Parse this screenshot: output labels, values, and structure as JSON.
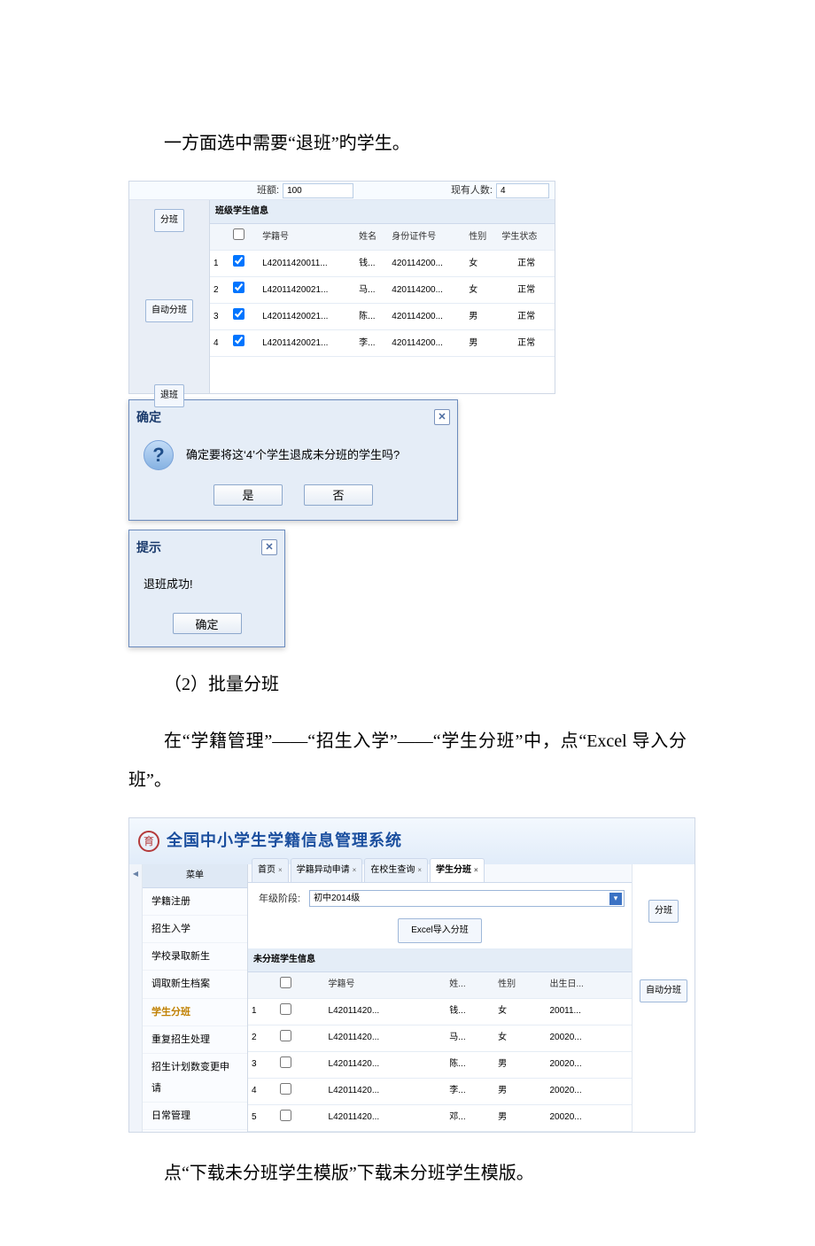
{
  "text": {
    "p1": "一方面选中需要“退班”旳学生。",
    "p2_a": "（2）批量分班",
    "p2_b": "在“学籍管理”——“招生入学”——“学生分班”中，点“Excel 导入分班”。",
    "p3": "点“下载未分班学生模版”下载未分班学生模版。"
  },
  "panel1": {
    "btn_fen": "分班",
    "btn_auto": "自动分班",
    "btn_tui": "退班",
    "lbl_ban_e": "班额:",
    "val_ban_e": "100",
    "lbl_xian": "现有人数:",
    "val_xian": "4",
    "section": "班级学生信息",
    "cols": [
      "",
      "",
      "学籍号",
      "姓名",
      "身份证件号",
      "性别",
      "学生状态"
    ],
    "rows": [
      {
        "n": "1",
        "chk": true,
        "id": "L42011420011...",
        "name": "钱...",
        "card": "420114200...",
        "sex": "女",
        "st": "正常"
      },
      {
        "n": "2",
        "chk": true,
        "id": "L42011420021...",
        "name": "马...",
        "card": "420114200...",
        "sex": "女",
        "st": "正常"
      },
      {
        "n": "3",
        "chk": true,
        "id": "L42011420021...",
        "name": "陈...",
        "card": "420114200...",
        "sex": "男",
        "st": "正常"
      },
      {
        "n": "4",
        "chk": true,
        "id": "L42011420021...",
        "name": "李...",
        "card": "420114200...",
        "sex": "男",
        "st": "正常"
      }
    ]
  },
  "dialog_confirm": {
    "title": "确定",
    "msg": "确定要将这‘4’个学生退成未分班的学生吗?",
    "yes": "是",
    "no": "否"
  },
  "dialog_tip": {
    "title": "提示",
    "msg": "退班成功!",
    "ok": "确定"
  },
  "panel2": {
    "banner_title": "全国中小学生学籍信息管理系统",
    "nav_header": "菜单",
    "nav": [
      {
        "label": "学籍注册",
        "sel": false
      },
      {
        "label": "招生入学",
        "sel": false
      },
      {
        "label": "学校录取新生",
        "sel": false
      },
      {
        "label": "调取新生档案",
        "sel": false
      },
      {
        "label": "学生分班",
        "sel": true
      },
      {
        "label": "重复招生处理",
        "sel": false
      },
      {
        "label": "招生计划数变更申请",
        "sel": false
      },
      {
        "label": "日常管理",
        "sel": false
      }
    ],
    "tabs": [
      "首页",
      "学籍异动申请",
      "在校生查询",
      "学生分班"
    ],
    "active_tab": 3,
    "grade_label": "年级阶段:",
    "grade_value": "初中2014级",
    "excel_btn": "Excel导入分班",
    "fen_btn": "分班",
    "auto_btn": "自动分班",
    "section": "未分班学生信息",
    "cols": [
      "",
      "",
      "学籍号",
      "姓...",
      "性别",
      "出生日..."
    ],
    "rows": [
      {
        "n": "1",
        "id": "L42011420...",
        "name": "钱...",
        "sex": "女",
        "dob": "20011..."
      },
      {
        "n": "2",
        "id": "L42011420...",
        "name": "马...",
        "sex": "女",
        "dob": "20020..."
      },
      {
        "n": "3",
        "id": "L42011420...",
        "name": "陈...",
        "sex": "男",
        "dob": "20020..."
      },
      {
        "n": "4",
        "id": "L42011420...",
        "name": "李...",
        "sex": "男",
        "dob": "20020..."
      },
      {
        "n": "5",
        "id": "L42011420...",
        "name": "邓...",
        "sex": "男",
        "dob": "20020..."
      }
    ]
  }
}
